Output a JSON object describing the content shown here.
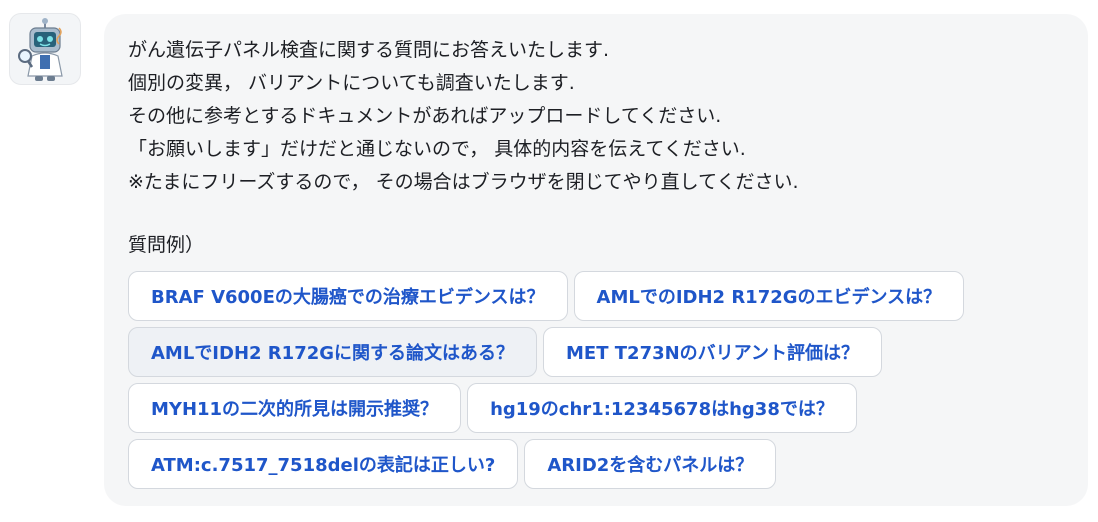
{
  "assistant": {
    "avatar_icon": "robot-scientist-icon",
    "message_lines": [
      "がん遺伝子パネル検査に関する質問にお答えいたします.",
      "個別の変異， バリアントについても調査いたします.",
      "その他に参考とするドキュメントがあればアップロードしてください.",
      "「お願いします」だけだと通じないので， 具体的内容を伝えてください.",
      "※たまにフリーズするので， その場合はブラウザを閉じてやり直してください."
    ],
    "examples_label": "質問例）",
    "examples": [
      [
        "BRAF V600Eの大腸癌での治療エビデンスは？",
        "AMLでのIDH2 R172Gのエビデンスは？"
      ],
      [
        "AMLでIDH2 R172Gに関する論文はある？",
        "MET T273Nのバリアント評価は？"
      ],
      [
        "MYH11の二次的所見は開示推奨？",
        "hg19のchr1:12345678はhg38では？"
      ],
      [
        "ATM:c.7517_7518delの表記は正しい?",
        "ARID2を含むパネルは？"
      ]
    ]
  },
  "colors": {
    "bubble_background": "#f5f6f7",
    "chip_text": "#1f56c9",
    "chip_border": "#d4d8de",
    "body_text": "#1d1f24"
  }
}
